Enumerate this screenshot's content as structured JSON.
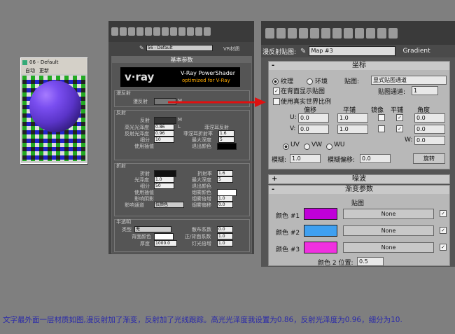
{
  "material_window": {
    "title": "06 - Default",
    "menu": [
      "自动",
      "更新"
    ],
    "colors": {
      "sphere": "#7a4ef0"
    }
  },
  "mid": {
    "dropdown": "56 - Default",
    "type_label": "VR材质",
    "section_basic": "基本参数",
    "vray_brand": "v·ray",
    "vray_title": "V-Ray PowerShader",
    "vray_sub": "optimized for V-Ray",
    "diffuse": {
      "header": "漫反射",
      "label": "漫反射",
      "m": "M"
    },
    "reflection": {
      "header": "反射",
      "reflect": "反射",
      "m": "M",
      "hilight": "高光光泽度",
      "hilight_val": "0.86",
      "L": "L",
      "refl_gloss": "反射光泽度",
      "refl_gloss_val": "0.96",
      "subdivs": "细分",
      "subdivs_val": "10",
      "interp": "使用插值",
      "fresnel": "菲涅耳反射",
      "fresnel_ior": "菲涅耳折射率",
      "fresnel_ior_val": "1.6",
      "max_depth": "最大深度",
      "max_depth_val": "5",
      "exit_color": "退出颜色"
    },
    "refraction": {
      "header": "折射",
      "refract": "折射",
      "ior": "折射率",
      "ior_val": "1.6",
      "gloss": "光泽度",
      "gloss_val": "1.0",
      "max_depth": "最大深度",
      "max_depth_val": "5",
      "subdivs": "细分",
      "subdivs_val": "50",
      "exit_color": "退出颜色",
      "interp": "使用插值",
      "fog_color": "烟雾颜色",
      "shadows": "影响阴影",
      "fog_mult": "烟雾倍增",
      "fog_mult_val": "1.0",
      "affect": "影响通道",
      "affect_val": "仅颜色",
      "fog_bias": "烟雾偏移",
      "fog_bias_val": "0.0"
    },
    "translucency": {
      "header": "半透明",
      "type": "类型",
      "type_val": "无",
      "back_color": "背面颜色",
      "thickness": "厚度",
      "thickness_val": "1000.0",
      "scatter": "散布系数",
      "scatter_val": "0.0",
      "fwd_back": "正/背面系数",
      "fwd_back_val": "1.0",
      "light_mult": "灯光倍增",
      "light_mult_val": "1.0"
    }
  },
  "right": {
    "diffuse_map_label": "漫反射贴图:",
    "map_name": "Map #3",
    "map_type": "Gradient",
    "coords": {
      "header": "坐标",
      "sign": "-",
      "texture": "纹理",
      "environ": "环境",
      "mapping_label": "贴图:",
      "mapping_val": "显式贴图通道",
      "show_back": "在背面显示贴图",
      "map_channel_label": "贴图通道:",
      "map_channel_val": "1",
      "real_world": "使用真实世界比例",
      "offset": "偏移",
      "tiling": "平铺",
      "mirror": "镜像",
      "tile": "平铺",
      "angle": "角度",
      "u": "U:",
      "v": "V:",
      "w": "W:",
      "u_offset": "0.0",
      "v_offset": "0.0",
      "u_tiling": "1.0",
      "v_tiling": "1.0",
      "u_angle": "0.0",
      "v_angle": "0.0",
      "w_angle": "0.0",
      "uv": "UV",
      "vw": "VW",
      "wu": "WU",
      "blur_label": "模糊:",
      "blur_val": "1.0",
      "blur_offset_label": "模糊偏移:",
      "blur_offset_val": "0.0",
      "rotate": "旋转"
    },
    "noise": {
      "header": "噪波",
      "sign": "+"
    },
    "gradient": {
      "header": "渐变参数",
      "sign": "-",
      "maps_label": "贴图",
      "color1": "颜色 #1",
      "color2": "颜色 #2",
      "color3": "颜色 #3",
      "none": "None",
      "pos_label": "颜色 2 位置:",
      "pos_val": "0.5",
      "colors": {
        "c1": "#c000d8",
        "c2": "#3fa0f0",
        "c3": "#f030e0"
      }
    }
  },
  "caption": "文字最外面一层材质如图,漫反射加了渐变，反射加了光线跟踪。高光光泽度我设置为0.86，反射光泽度为0.96，细分为10."
}
